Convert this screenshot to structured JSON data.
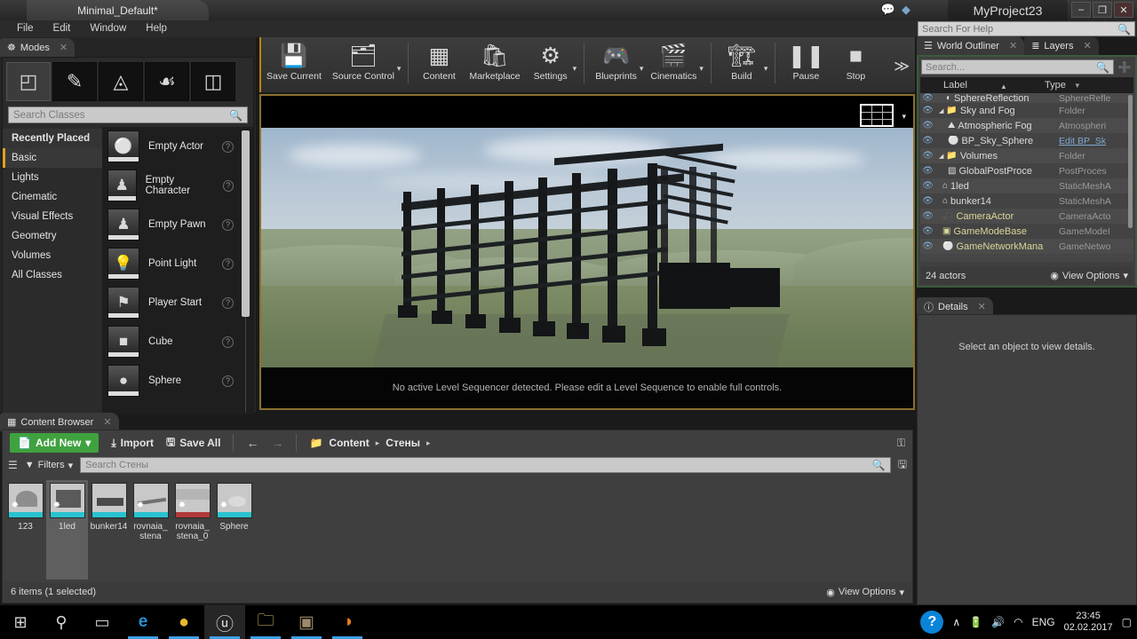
{
  "titlebar": {
    "level_tab": "Minimal_Default*",
    "project_name": "MyProject23",
    "minimize": "–",
    "restore": "❐",
    "close": "✕",
    "icon_chat": "💬",
    "icon_gem": "◆"
  },
  "menubar": {
    "items": [
      "File",
      "Edit",
      "Window",
      "Help"
    ],
    "help_search_placeholder": "Search For Help"
  },
  "modes": {
    "tab_label": "Modes",
    "tab_close": "✕",
    "mode_buttons": [
      {
        "name": "place-mode",
        "glyph": "◰"
      },
      {
        "name": "paint-mode",
        "glyph": "✎"
      },
      {
        "name": "landscape-mode",
        "glyph": "◬"
      },
      {
        "name": "foliage-mode",
        "glyph": "☙"
      },
      {
        "name": "geometry-editing-mode",
        "glyph": "◫"
      }
    ],
    "search_placeholder": "Search Classes",
    "categories": [
      "Recently Placed",
      "Basic",
      "Lights",
      "Cinematic",
      "Visual Effects",
      "Geometry",
      "Volumes",
      "All Classes"
    ],
    "selected_category": "Basic",
    "items": [
      {
        "label": "Empty Actor",
        "glyph": "⚪"
      },
      {
        "label": "Empty Character",
        "glyph": "♟"
      },
      {
        "label": "Empty Pawn",
        "glyph": "♟"
      },
      {
        "label": "Point Light",
        "glyph": "💡"
      },
      {
        "label": "Player Start",
        "glyph": "⚑"
      },
      {
        "label": "Cube",
        "glyph": "■"
      },
      {
        "label": "Sphere",
        "glyph": "●"
      }
    ],
    "help_glyph": "?"
  },
  "toolbar": {
    "groups": [
      {
        "buttons": [
          {
            "label": "Save Current",
            "icon": "save-icon",
            "glyph": "💾",
            "caret": false
          },
          {
            "label": "Source Control",
            "icon": "source-control-icon",
            "glyph": "🗂",
            "caret": true
          }
        ]
      },
      {
        "buttons": [
          {
            "label": "Content",
            "icon": "content-icon",
            "glyph": "▦",
            "caret": false
          },
          {
            "label": "Marketplace",
            "icon": "marketplace-icon",
            "glyph": "🛍",
            "caret": false
          },
          {
            "label": "Settings",
            "icon": "settings-icon",
            "glyph": "⚙",
            "caret": true
          }
        ]
      },
      {
        "buttons": [
          {
            "label": "Blueprints",
            "icon": "blueprints-icon",
            "glyph": "🎮",
            "caret": true
          },
          {
            "label": "Cinematics",
            "icon": "cinematics-icon",
            "glyph": "🎬",
            "caret": true
          }
        ]
      },
      {
        "buttons": [
          {
            "label": "Build",
            "icon": "build-icon",
            "glyph": "🏗",
            "caret": true
          }
        ]
      },
      {
        "buttons": [
          {
            "label": "Pause",
            "icon": "pause-icon",
            "glyph": "❚❚",
            "caret": false
          },
          {
            "label": "Stop",
            "icon": "stop-icon",
            "glyph": "■",
            "caret": false
          }
        ]
      }
    ],
    "overflow": "≫"
  },
  "viewport": {
    "sequencer_message": "No active Level Sequencer detected. Please edit a Level Sequence to enable full controls.",
    "grid_overlay_caret": "▾"
  },
  "world_outliner": {
    "tabs": [
      {
        "label": "World Outliner",
        "icon": "outliner-icon",
        "glyph": "☰",
        "active": true,
        "close": "✕"
      },
      {
        "label": "Layers",
        "icon": "layers-icon",
        "glyph": "≣",
        "active": false,
        "close": "✕"
      }
    ],
    "search_placeholder": "Search...",
    "add_glyph": "➕",
    "columns": {
      "label": "Label",
      "type": "Type"
    },
    "sort_asc": "▲",
    "sort_desc": "▼",
    "rows": [
      {
        "label": "SphereReflection",
        "type": "SphereRefle",
        "glyph": "◐",
        "indent": 28,
        "color": "w",
        "partial": true
      },
      {
        "label": "Sky and Fog",
        "type": "Folder",
        "glyph": "📁",
        "indent": 16,
        "color": "w",
        "expander": "◢"
      },
      {
        "label": "Atmospheric Fog",
        "type": "Atmospheri",
        "glyph": "⛰",
        "indent": 28,
        "color": "w"
      },
      {
        "label": "BP_Sky_Sphere",
        "type": "Edit BP_Sk",
        "glyph": "⚪",
        "indent": 28,
        "color": "w",
        "type_link": true
      },
      {
        "label": "Volumes",
        "type": "Folder",
        "glyph": "📁",
        "indent": 16,
        "color": "w",
        "expander": "◢"
      },
      {
        "label": "GlobalPostProce",
        "type": "PostProces",
        "glyph": "▧",
        "indent": 28,
        "color": "w"
      },
      {
        "label": "1led",
        "type": "StaticMeshA",
        "glyph": "⌂",
        "indent": 14,
        "color": "w"
      },
      {
        "label": "bunker14",
        "type": "StaticMeshA",
        "glyph": "⌂",
        "indent": 14,
        "color": "w"
      },
      {
        "label": "CameraActor",
        "type": "CameraActo",
        "glyph": "🎥",
        "indent": 14,
        "color": "y"
      },
      {
        "label": "GameModeBase",
        "type": "GameModeI",
        "glyph": "▣",
        "indent": 14,
        "color": "y"
      },
      {
        "label": "GameNetworkMana",
        "type": "GameNetwo",
        "glyph": "⚪",
        "indent": 14,
        "color": "y"
      }
    ],
    "footer": {
      "count": "24 actors",
      "view_options": "View Options",
      "eye": "◉",
      "caret": "▾"
    }
  },
  "details": {
    "tab_label": "Details",
    "tab_icon": "ⓘ",
    "tab_close": "✕",
    "empty_message": "Select an object to view details."
  },
  "content_browser": {
    "tab_label": "Content Browser",
    "tab_close": "✕",
    "add_new": "Add New",
    "add_new_caret": "▾",
    "import": "Import",
    "save_all": "Save All",
    "back_arrow": "←",
    "forward_arrow": "→",
    "breadcrumb": [
      "Content",
      "Стены"
    ],
    "breadcrumb_sep": "▸",
    "lock_glyph": "⚿",
    "filters_label": "Filters",
    "filters_caret": "▾",
    "search_placeholder": "Search Стены",
    "assets": [
      {
        "name": "123",
        "selected": false,
        "bar": "cyan",
        "badge": "✸"
      },
      {
        "name": "1led",
        "selected": true,
        "bar": "cyan",
        "badge": "✸"
      },
      {
        "name": "bunker14",
        "selected": false,
        "bar": "cyan",
        "badge": ""
      },
      {
        "name": "rovnaia_ stena",
        "selected": false,
        "bar": "cyan",
        "badge": "✸"
      },
      {
        "name": "rovnaia_ stena_0",
        "selected": false,
        "bar": "red",
        "badge": "✸"
      },
      {
        "name": "Sphere",
        "selected": false,
        "bar": "cyan",
        "badge": "✸"
      }
    ],
    "footer": {
      "status": "6 items (1 selected)",
      "view_options": "View Options",
      "eye": "◉",
      "caret": "▾"
    }
  },
  "taskbar": {
    "items": [
      {
        "name": "start-button",
        "glyph": "⊞",
        "active": false,
        "running": false
      },
      {
        "name": "search-taskbar-button",
        "glyph": "⚲",
        "active": false,
        "running": false
      },
      {
        "name": "task-view-button",
        "glyph": "▭",
        "active": false,
        "running": false
      },
      {
        "name": "edge-taskbar-icon",
        "glyph": "e",
        "active": false,
        "running": true
      },
      {
        "name": "chrome-taskbar-icon",
        "glyph": "●",
        "active": false,
        "running": true
      },
      {
        "name": "unreal-taskbar-icon",
        "glyph": "ⓤ",
        "active": true,
        "running": true
      },
      {
        "name": "file-explorer-taskbar-icon",
        "glyph": "🗀",
        "active": false,
        "running": true
      },
      {
        "name": "game-taskbar-icon",
        "glyph": "▣",
        "active": false,
        "running": true
      },
      {
        "name": "blender-taskbar-icon",
        "glyph": "◑",
        "active": false,
        "running": true
      }
    ],
    "tray": {
      "help": "?",
      "chevron": "∧",
      "battery": "🔋",
      "volume": "🔊",
      "wifi": "◠",
      "language": "ENG",
      "time": "23:45",
      "date": "02.02.2017",
      "notifications": "▢"
    }
  },
  "colors": {
    "accent_orange": "#e2a022",
    "green_panel_border": "#3c5c3c",
    "add_new_green": "#3fa23f",
    "viewport_border": "#8a7030",
    "asset_bar_cyan": "#29c3cf",
    "taskbar_active_blue": "#3ba0e8"
  }
}
